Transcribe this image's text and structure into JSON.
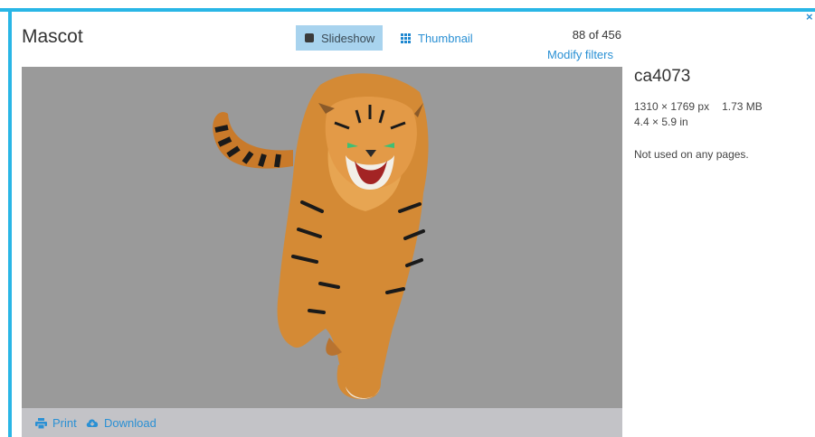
{
  "window": {
    "title": "Mascot",
    "close_label": "×"
  },
  "view_tabs": {
    "slideshow": "Slideshow",
    "thumbnail": "Thumbnail",
    "active": "slideshow"
  },
  "position": {
    "counter": "88 of 456",
    "modify_filters": "Modify filters"
  },
  "image": {
    "name": "ca4073",
    "dimensions_px": "1310 × 1769 px",
    "file_size": "1.73 MB",
    "dimensions_in": "4.4 × 5.9 in",
    "usage": "Not used on any pages.",
    "subject": "tiger-illustration"
  },
  "footer": {
    "print_label": "Print",
    "download_label": "Download"
  },
  "colors": {
    "accent": "#29b6e6",
    "link": "#2a90d4",
    "tab_active_bg": "#a8d3ee",
    "viewer_bg": "#9a9a9a",
    "footer_bg": "#c3c3c7"
  },
  "icons": {
    "slideshow": "square-icon",
    "thumbnail": "grid-icon",
    "print": "printer-icon",
    "download": "cloud-download-icon",
    "close": "close-icon"
  }
}
